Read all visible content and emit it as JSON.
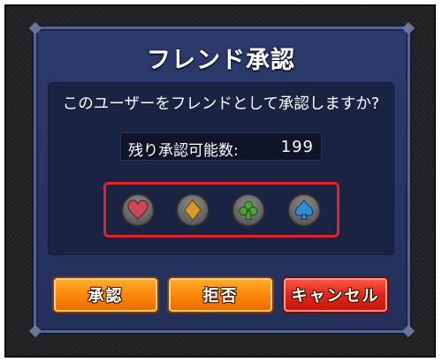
{
  "dialog": {
    "title": "フレンド承認",
    "question": "このユーザーをフレンドとして承認しますか?",
    "approval_count_label": "残り承認可能数:",
    "approval_count_value": "199"
  },
  "suits": [
    {
      "icon": "heart-icon",
      "color": "#c74a56"
    },
    {
      "icon": "diamond-icon",
      "color": "#d39a2c"
    },
    {
      "icon": "club-icon",
      "color": "#4fa03a"
    },
    {
      "icon": "spade-icon",
      "color": "#2f8fd0"
    }
  ],
  "buttons": {
    "approve_label": "承認",
    "reject_label": "拒否",
    "cancel_label": "キャンセル"
  },
  "colors": {
    "highlight_border": "#e0232e",
    "approve_button": "#ff8a0d",
    "reject_button": "#ff8a0d",
    "cancel_button": "#e2261a"
  }
}
